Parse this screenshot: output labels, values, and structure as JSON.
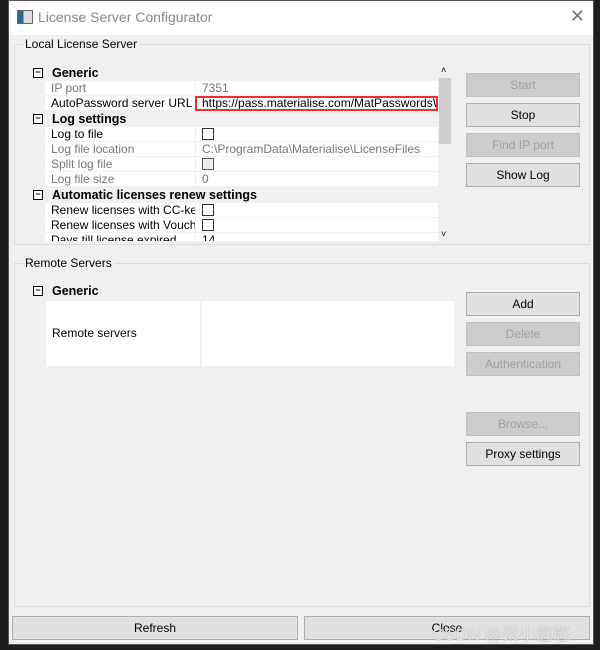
{
  "window": {
    "title": "License Server Configurator",
    "close_icon": "close-icon"
  },
  "local": {
    "label": "Local License Server",
    "rows": [
      {
        "type": "cat",
        "text": "Generic"
      },
      {
        "type": "prop",
        "label": "IP port",
        "value": "7351",
        "dim": true
      },
      {
        "type": "prop",
        "label": "AutoPassword server URL",
        "value": "https://pass.materialise.com/MatPasswordsWS/MatPasswordsWS",
        "highlight": true
      },
      {
        "type": "cat",
        "text": "Log settings"
      },
      {
        "type": "prop",
        "label": "Log to file",
        "checkbox": true
      },
      {
        "type": "prop",
        "label": "Log file location",
        "value": "C:\\ProgramData\\Materialise\\LicenseFiles",
        "dim": true
      },
      {
        "type": "prop",
        "label": "Split log file",
        "checkbox": true,
        "dim": true
      },
      {
        "type": "prop",
        "label": "Log file size",
        "value": "0",
        "dim": true
      },
      {
        "type": "cat",
        "text": "Automatic licenses renew settings"
      },
      {
        "type": "prop",
        "label": "Renew licenses with CC-key",
        "checkbox": true
      },
      {
        "type": "prop",
        "label": "Renew licenses with Vouch...",
        "checkbox": true
      },
      {
        "type": "prop",
        "label": "Days till license expired",
        "value": "14"
      }
    ],
    "buttons": [
      {
        "label": "Start",
        "disabled": true
      },
      {
        "label": "Stop"
      },
      {
        "label": "Find IP port",
        "disabled": true
      },
      {
        "label": "Show Log"
      }
    ]
  },
  "remote": {
    "label": "Remote Servers",
    "category": "Generic",
    "row_label": "Remote servers",
    "buttons": [
      {
        "label": "Add"
      },
      {
        "label": "Delete",
        "disabled": true
      },
      {
        "label": "Authentication",
        "disabled": true
      },
      {
        "label": "Browse...",
        "disabled": true
      },
      {
        "label": "Proxy settings"
      }
    ]
  },
  "footer": {
    "refresh": "Refresh",
    "close": "Close"
  },
  "watermark": "CSDN @梁小憨憨",
  "colors": {
    "highlight": "#e53333"
  }
}
